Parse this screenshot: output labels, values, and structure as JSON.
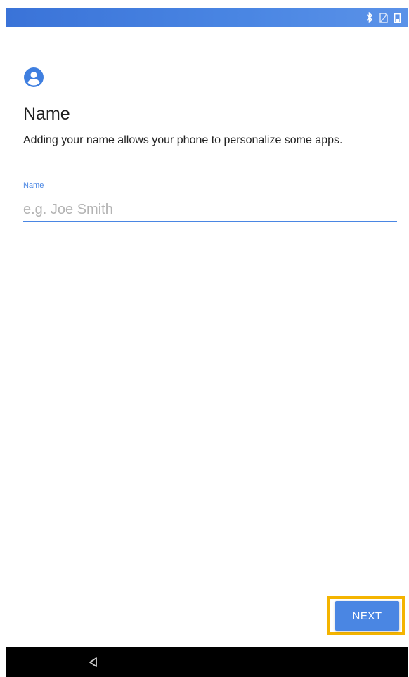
{
  "status_bar": {
    "icons": [
      "bluetooth-icon",
      "no-sim-icon",
      "battery-icon"
    ],
    "color": "#4a86e3"
  },
  "page": {
    "icon": "account-circle-icon",
    "title": "Name",
    "subtitle": "Adding your name allows your phone to personalize some apps."
  },
  "name_field": {
    "label": "Name",
    "placeholder": "e.g. Joe Smith",
    "value": ""
  },
  "actions": {
    "next_label": "NEXT",
    "highlight_color": "#f4b400"
  },
  "nav_bar": {
    "buttons": [
      "back-icon"
    ]
  }
}
